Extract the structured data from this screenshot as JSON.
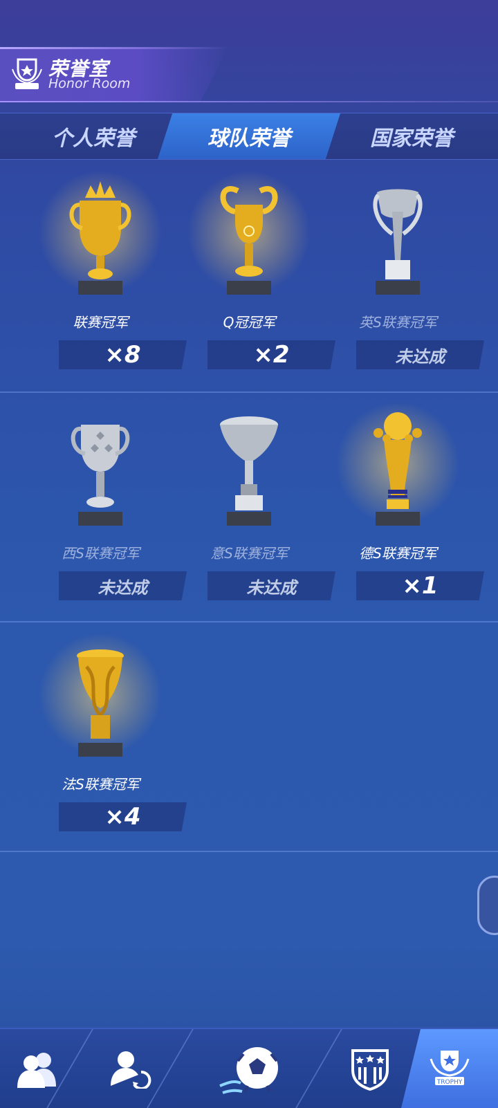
{
  "header": {
    "title_cn": "荣誉室",
    "title_en": "Honor Room",
    "badge_text": "TROPHY"
  },
  "tabs": [
    {
      "label": "个人荣誉",
      "active": false
    },
    {
      "label": "球队荣誉",
      "active": true
    },
    {
      "label": "国家荣誉",
      "active": false
    }
  ],
  "trophies": [
    {
      "name": "联赛冠军",
      "count": "×8",
      "achieved": true,
      "icon": "crown-trophy-icon"
    },
    {
      "name": "Q冠冠军",
      "count": "×2",
      "achieved": true,
      "icon": "big-ears-trophy-icon"
    },
    {
      "name": "英S联赛冠军",
      "count": "未达成",
      "achieved": false,
      "icon": "winged-trophy-icon"
    },
    {
      "name": "西S联赛冠军",
      "count": "未达成",
      "achieved": false,
      "icon": "silver-cup-icon"
    },
    {
      "name": "意S联赛冠军",
      "count": "未达成",
      "achieved": false,
      "icon": "funnel-trophy-icon"
    },
    {
      "name": "德S联赛冠军",
      "count": "×1",
      "achieved": true,
      "icon": "ball-trophy-icon"
    },
    {
      "name": "法S联赛冠军",
      "count": "×4",
      "achieved": true,
      "icon": "twisted-trophy-icon"
    }
  ],
  "bottom_nav": [
    {
      "icon": "team-icon"
    },
    {
      "icon": "transfer-icon"
    },
    {
      "icon": "soccer-ball-icon"
    },
    {
      "icon": "club-crest-icon"
    },
    {
      "icon": "trophy-badge-icon",
      "active": true
    }
  ],
  "colors": {
    "gold": "#f2c230",
    "silver": "#c9ced6",
    "accent": "#3b80e5"
  }
}
